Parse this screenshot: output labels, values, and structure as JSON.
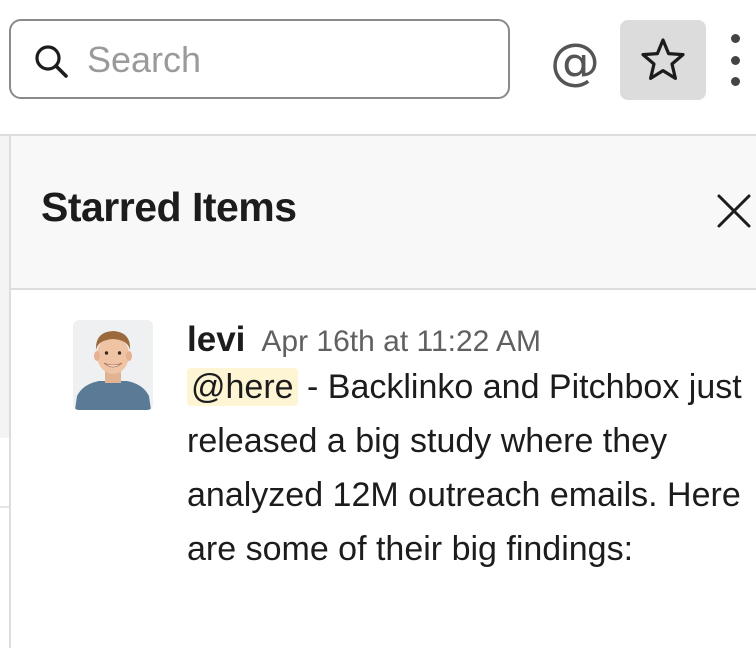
{
  "search": {
    "placeholder": "Search"
  },
  "topbar": {
    "mention_symbol": "@"
  },
  "pane": {
    "title": "Starred Items"
  },
  "message": {
    "sender": "levi",
    "timestamp": "Apr 16th at 11:22 AM",
    "mention": "@here",
    "text": " - Backlinko and Pitchbox just released a big study where they analyzed 12M outreach emails. Here are some of their big findings:"
  },
  "colors": {
    "star_button_bg": "#dcdcdc",
    "mention_highlight": "#fdf5d4",
    "header_bg": "#f8f8f8"
  }
}
